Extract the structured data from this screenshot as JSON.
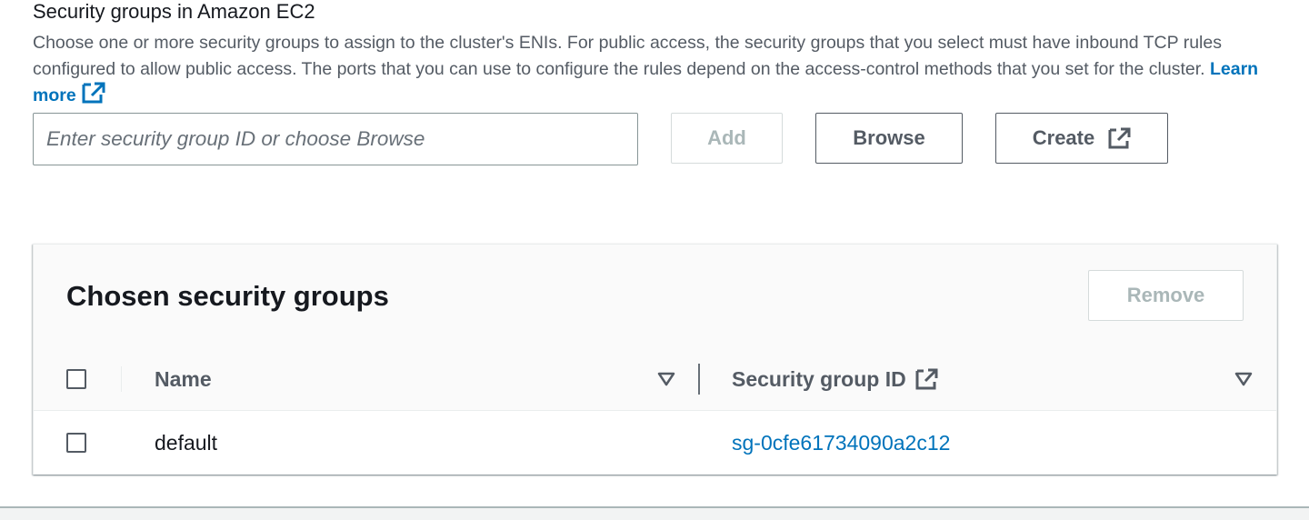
{
  "security_groups_field": {
    "label": "Security groups in Amazon EC2",
    "description": "Choose one or more security groups to assign to the cluster's ENIs. For public access, the security groups that you select must have inbound TCP rules configured to allow public access. The ports that you can use to configure the rules depend on the access-control methods that you set for the cluster.",
    "learn_more_label": "Learn more",
    "input_placeholder": "Enter security group ID or choose Browse",
    "input_value": "",
    "add_label": "Add",
    "browse_label": "Browse",
    "create_label": "Create"
  },
  "chosen_table": {
    "title": "Chosen security groups",
    "remove_label": "Remove",
    "columns": [
      {
        "label": "Name"
      },
      {
        "label": "Security group ID"
      }
    ],
    "rows": [
      {
        "name": "default",
        "security_group_id": "sg-0cfe61734090a2c12"
      }
    ]
  },
  "colors": {
    "link": "#0073bb",
    "text": "#16191f",
    "secondary_text": "#545b64",
    "disabled": "#aab7b8"
  },
  "icons": {
    "external_link": "external-link-icon",
    "sort": "sort-down-icon"
  }
}
